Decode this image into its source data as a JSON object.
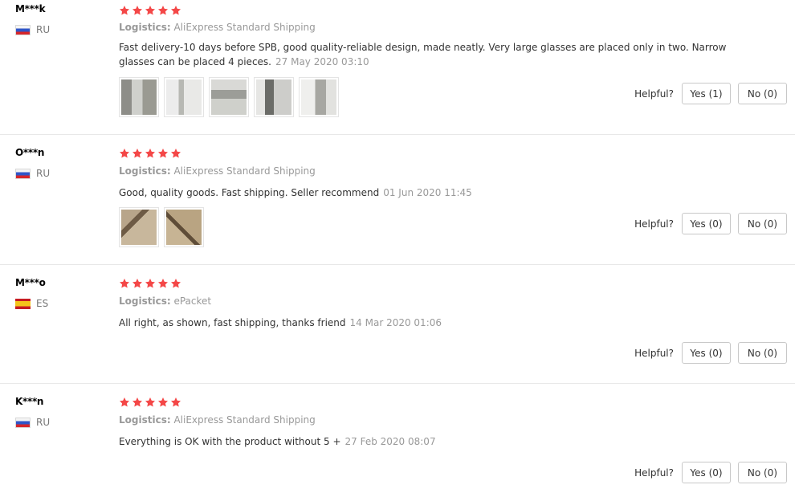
{
  "colors": {
    "star": "#f44747",
    "muted": "#999999",
    "text": "#333333",
    "divider": "#e8e8e8"
  },
  "labels": {
    "logistics_label": "Logistics:",
    "helpful_label": "Helpful?"
  },
  "reviews": [
    {
      "user": "M***k",
      "country": "RU",
      "rating": 5,
      "logistics": "AliExpress Standard Shipping",
      "text": "Fast delivery-10 days before SPB, good quality-reliable design, made neatly. Very large glasses are placed only in two. Narrow glasses can be placed 4 pieces.",
      "date": "27 May 2020 03:10",
      "photo_count": 5,
      "yes": "Yes (1)",
      "no": "No (0)"
    },
    {
      "user": "O***n",
      "country": "RU",
      "rating": 5,
      "logistics": "AliExpress Standard Shipping",
      "text": "Good, quality goods. Fast shipping. Seller recommend",
      "date": "01 Jun 2020 11:45",
      "photo_count": 2,
      "yes": "Yes (0)",
      "no": "No (0)"
    },
    {
      "user": "M***o",
      "country": "ES",
      "rating": 5,
      "logistics": "ePacket",
      "text": "All right, as shown, fast shipping, thanks friend",
      "date": "14 Mar 2020 01:06",
      "photo_count": 0,
      "yes": "Yes (0)",
      "no": "No (0)"
    },
    {
      "user": "K***n",
      "country": "RU",
      "rating": 5,
      "logistics": "AliExpress Standard Shipping",
      "text": "Everything is OK with the product without 5 +",
      "date": "27 Feb 2020 08:07",
      "photo_count": 0,
      "yes": "Yes (0)",
      "no": "No (0)"
    }
  ]
}
